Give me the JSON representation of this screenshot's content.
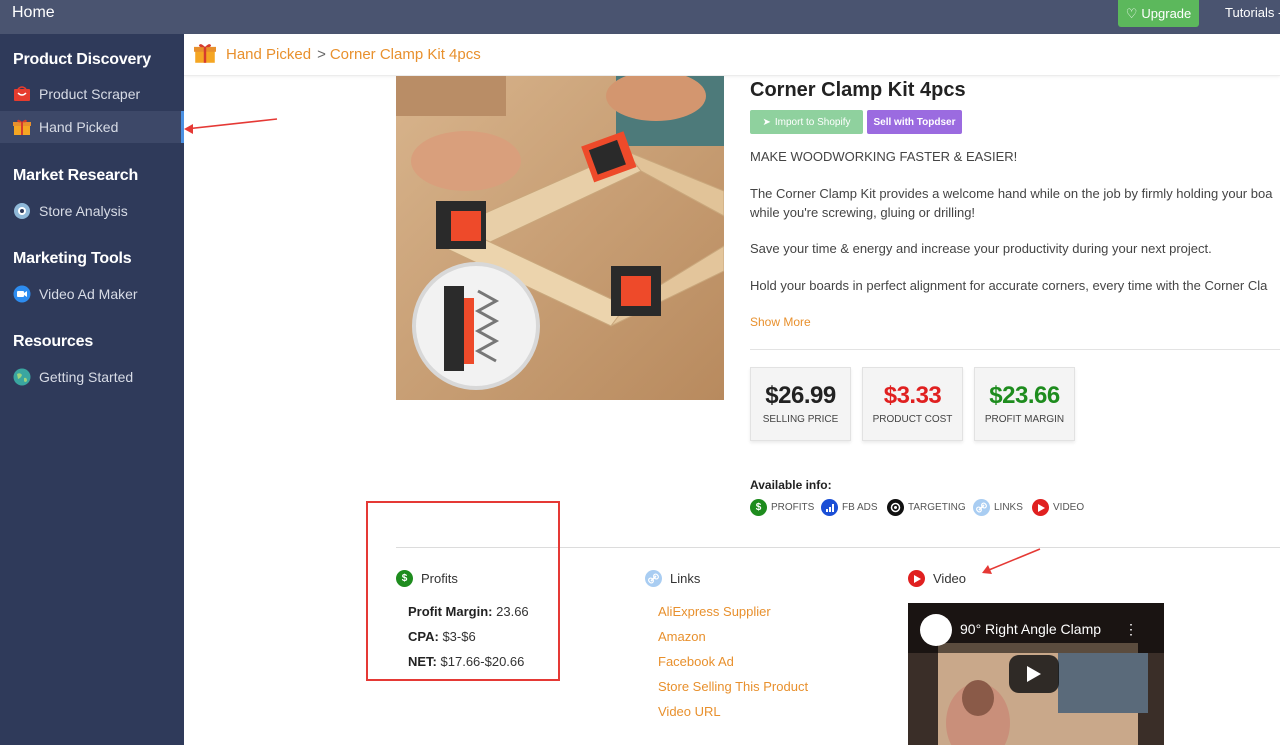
{
  "topbar": {
    "home_label": "Home",
    "upgrade_label": "Upgrade",
    "tutorials_label": "Tutorials -"
  },
  "sidebar": {
    "sections": [
      {
        "title": "Product Discovery",
        "items": [
          {
            "label": "Product Scraper",
            "icon": "cart-icon"
          },
          {
            "label": "Hand Picked",
            "icon": "gift-icon",
            "active": true
          }
        ]
      },
      {
        "title": "Market Research",
        "items": [
          {
            "label": "Store Analysis",
            "icon": "eye-icon"
          }
        ]
      },
      {
        "title": "Marketing Tools",
        "items": [
          {
            "label": "Video Ad Maker",
            "icon": "video-camera-icon"
          }
        ]
      },
      {
        "title": "Resources",
        "items": [
          {
            "label": "Getting Started",
            "icon": "globe-icon"
          }
        ]
      }
    ]
  },
  "breadcrumb": {
    "icon": "gift-icon",
    "parent": "Hand Picked",
    "separator": ">",
    "current": "Corner Clamp Kit 4pcs"
  },
  "product": {
    "title": "Corner Clamp Kit 4pcs",
    "import_button": "Import to Shopify",
    "sell_button": "Sell with Topdser",
    "description": [
      "MAKE WOODWORKING FASTER & EASIER!",
      "The Corner Clamp Kit provides a welcome hand while on the job by firmly holding your boa",
      "while you're screwing, gluing or drilling!",
      "Save your time & energy and increase your productivity during your next project.",
      "Hold your boards in perfect alignment for accurate corners, every time with the Corner Cla"
    ],
    "show_more": "Show More",
    "prices": [
      {
        "value": "$26.99",
        "label": "SELLING PRICE",
        "color": "#222222"
      },
      {
        "value": "$3.33",
        "label": "PRODUCT COST",
        "color": "#e02020"
      },
      {
        "value": "$23.66",
        "label": "PROFIT MARGIN",
        "color": "#1e8c1e"
      }
    ],
    "available_info_title": "Available info:",
    "available_info": [
      {
        "label": "PROFITS",
        "icon": "dollar-icon",
        "color": "#1e8c1e"
      },
      {
        "label": "FB ADS",
        "icon": "bar-chart-icon",
        "color": "#1b4fd6"
      },
      {
        "label": "TARGETING",
        "icon": "target-icon",
        "color": "#111111"
      },
      {
        "label": "LINKS",
        "icon": "link-icon",
        "color": "#7fb3ea"
      },
      {
        "label": "VIDEO",
        "icon": "play-icon",
        "color": "#e02020"
      }
    ]
  },
  "profits": {
    "title": "Profits",
    "rows": [
      {
        "key": "Profit Margin:",
        "value": "23.66"
      },
      {
        "key": "CPA:",
        "value": "$3-$6"
      },
      {
        "key": "NET:",
        "value": "$17.66-$20.66"
      }
    ]
  },
  "links": {
    "title": "Links",
    "items": [
      "AliExpress Supplier",
      "Amazon",
      "Facebook Ad",
      "Store Selling This Product",
      "Video URL"
    ]
  },
  "video": {
    "title": "Video",
    "video_title": "90° Right Angle Clamp"
  }
}
